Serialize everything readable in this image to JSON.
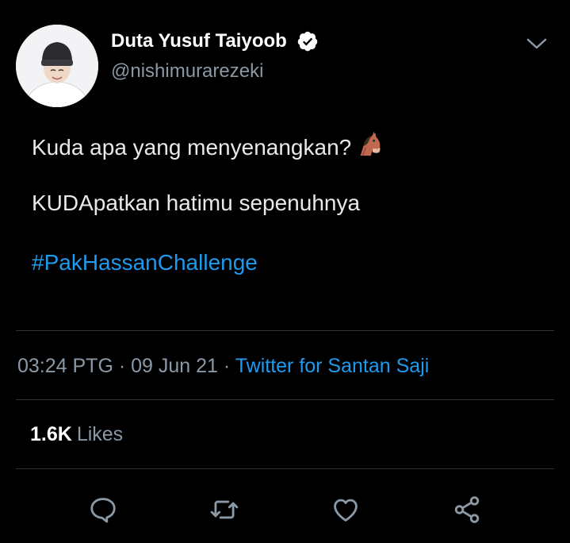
{
  "tweet": {
    "display_name": "Duta Yusuf Taiyoob",
    "handle": "@nishimurarezeki",
    "line1": "Kuda apa yang menyenangkan?",
    "line2": "KUDApatkan hatimu sepenuhnya",
    "hashtag": "#PakHassanChallenge",
    "time": "03:24 PTG",
    "date": "09 Jun 21",
    "separator": "·",
    "source": "Twitter for Santan Saji",
    "likes_count": "1.6K",
    "likes_label": "Likes"
  },
  "icons": {
    "verified": "verified-badge-icon",
    "caret": "chevron-down-icon",
    "horse": "horse-face-emoji",
    "reply": "reply-icon",
    "retweet": "retweet-icon",
    "like": "heart-icon",
    "share": "share-icon"
  },
  "colors": {
    "background": "#000000",
    "text": "#e7e9ea",
    "muted": "#8b98a5",
    "accent": "#1d9bf0",
    "divider": "#2f3336"
  }
}
